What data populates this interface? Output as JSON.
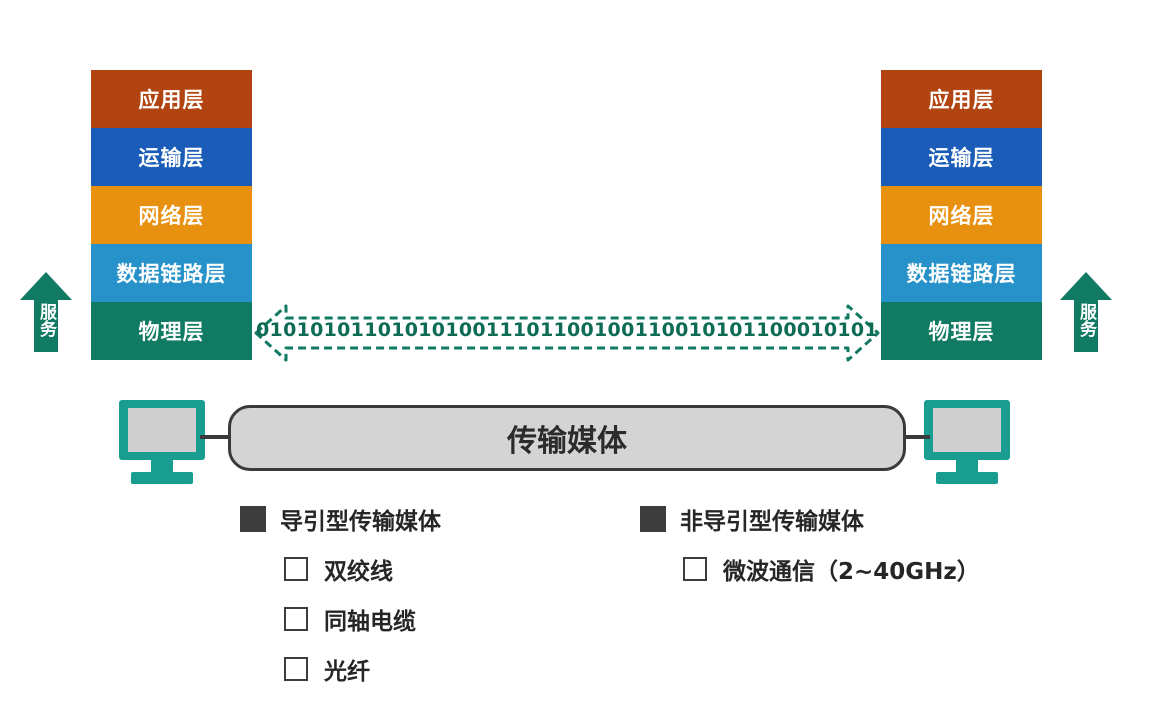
{
  "left_stack": {
    "layers": [
      "应用层",
      "运输层",
      "网络层",
      "数据链路层",
      "物理层"
    ]
  },
  "right_stack": {
    "layers": [
      "应用层",
      "运输层",
      "网络层",
      "数据链路层",
      "物理层"
    ]
  },
  "service_label": "服务",
  "bitstream": "0101010110101010011101100100110010101100010101",
  "medium_label": "传输媒体",
  "guided": {
    "title": "导引型传输媒体",
    "items": [
      "双绞线",
      "同轴电缆",
      "光纤"
    ]
  },
  "unguided": {
    "title": "非导引型传输媒体",
    "items": [
      "微波通信（2~40GHz）"
    ]
  },
  "colors": {
    "application": "#b14410",
    "transport": "#1a5cb8",
    "network": "#e8900f",
    "datalink": "#2791c9",
    "physical": "#107a62",
    "arrow_green": "#107a62",
    "computer_teal": "#1a9d91"
  }
}
